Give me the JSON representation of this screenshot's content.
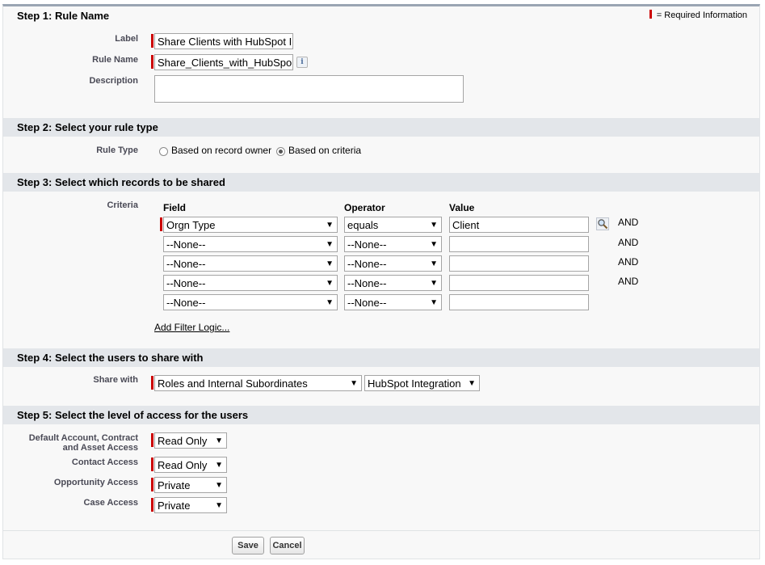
{
  "required_info": "= Required Information",
  "step1": {
    "title": "Step 1: Rule Name",
    "label_label": "Label",
    "label_value": "Share Clients with HubSpot I",
    "rule_name_label": "Rule Name",
    "rule_name_value": "Share_Clients_with_HubSpo",
    "info_icon": "i",
    "description_label": "Description",
    "description_value": ""
  },
  "step2": {
    "title": "Step 2: Select your rule type",
    "rule_type_label": "Rule Type",
    "option_owner": "Based on record owner",
    "option_criteria": "Based on criteria",
    "selected": "criteria"
  },
  "step3": {
    "title": "Step 3: Select which records to be shared",
    "criteria_label": "Criteria",
    "col_field": "Field",
    "col_operator": "Operator",
    "col_value": "Value",
    "rows": [
      {
        "field": "Orgn Type",
        "operator": "equals",
        "value": "Client",
        "conj": "AND"
      },
      {
        "field": "--None--",
        "operator": "--None--",
        "value": "",
        "conj": "AND"
      },
      {
        "field": "--None--",
        "operator": "--None--",
        "value": "",
        "conj": "AND"
      },
      {
        "field": "--None--",
        "operator": "--None--",
        "value": "",
        "conj": "AND"
      },
      {
        "field": "--None--",
        "operator": "--None--",
        "value": "",
        "conj": ""
      }
    ],
    "add_filter_logic": "Add Filter Logic..."
  },
  "step4": {
    "title": "Step 4: Select the users to share with",
    "share_with_label": "Share with",
    "share_type": "Roles and Internal Subordinates",
    "share_target": "HubSpot Integration"
  },
  "step5": {
    "title": "Step 5: Select the level of access for the users",
    "default_access_label_1": "Default Account, Contract",
    "default_access_label_2": "and Asset Access",
    "default_access_value": "Read Only",
    "contact_label": "Contact Access",
    "contact_value": "Read Only",
    "opportunity_label": "Opportunity Access",
    "opportunity_value": "Private",
    "case_label": "Case Access",
    "case_value": "Private"
  },
  "buttons": {
    "save": "Save",
    "cancel": "Cancel"
  },
  "colors": {
    "required": "#cc0000",
    "section_header": "#e3e6ea",
    "panel_top_border": "#9aa5b3"
  }
}
